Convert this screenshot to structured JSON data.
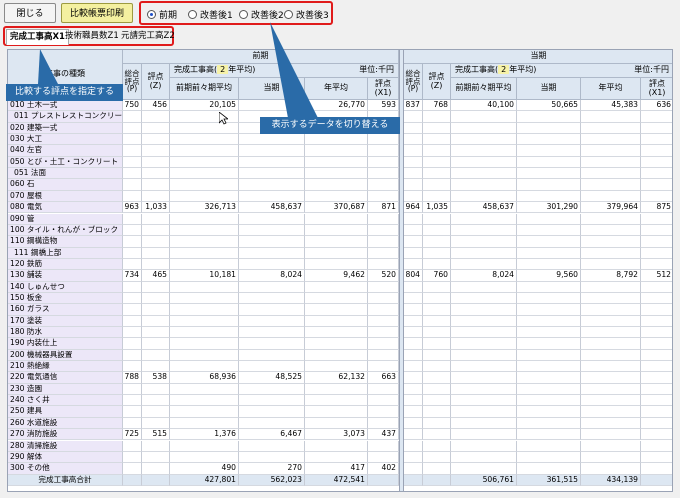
{
  "toolbar": {
    "close_label": "閉じる",
    "print_label": "比較帳票印刷"
  },
  "radios": [
    {
      "label": "前期",
      "selected": true
    },
    {
      "label": "改善後1",
      "selected": false
    },
    {
      "label": "改善後2",
      "selected": false
    },
    {
      "label": "改善後3",
      "selected": false
    }
  ],
  "tabs": [
    "完成工事高X1",
    "技術職員数Z1",
    "元請完工高Z2"
  ],
  "callouts": {
    "left": "比較する評点を指定する",
    "right": "表示するデータを切り替える"
  },
  "table": {
    "row_header": "工事の種類",
    "left_group": "前期",
    "right_group": "当期",
    "left_sub": "完成工事高(",
    "left_sub_val": "2",
    "left_sub_tail": "年平均)",
    "right_sub": "完成工事高(",
    "right_sub_val": "2",
    "right_sub_tail": "年平均)",
    "unit": "単位:千円",
    "col_sogo": "総合評点(P)",
    "col_hyoten_z": "評点(Z)",
    "col_prev_avg": "前期前々期平均",
    "col_curr": "当期",
    "col_year_avg": "年平均",
    "col_hyoten_x1": "評点(X1)",
    "total_label": "完成工事高合計"
  },
  "rows": [
    {
      "label": "010 土木一式",
      "l": [
        "750",
        "456",
        "20,105",
        "40,",
        "26,770",
        "593"
      ],
      "r": [
        "837",
        "768",
        "40,100",
        "50,665",
        "45,383",
        "636"
      ]
    },
    {
      "label": "011 プレストレストコンクリート",
      "l": [
        "",
        "",
        "",
        "",
        "",
        ""
      ],
      "r": [
        "",
        "",
        "",
        "",
        "",
        ""
      ],
      "sub": true
    },
    {
      "label": "020 建築一式",
      "l": [
        "",
        "",
        "",
        "",
        "",
        ""
      ],
      "r": [
        "",
        "",
        "",
        "",
        "",
        ""
      ]
    },
    {
      "label": "030 大工",
      "l": [
        "",
        "",
        "",
        "",
        "",
        ""
      ],
      "r": [
        "",
        "",
        "",
        "",
        "",
        ""
      ]
    },
    {
      "label": "040 左官",
      "l": [
        "",
        "",
        "",
        "",
        "",
        ""
      ],
      "r": [
        "",
        "",
        "",
        "",
        "",
        ""
      ]
    },
    {
      "label": "050 とび・土工・コンクリート",
      "l": [
        "",
        "",
        "",
        "",
        "",
        ""
      ],
      "r": [
        "",
        "",
        "",
        "",
        "",
        ""
      ]
    },
    {
      "label": "051 法面",
      "l": [
        "",
        "",
        "",
        "",
        "",
        ""
      ],
      "r": [
        "",
        "",
        "",
        "",
        "",
        ""
      ],
      "sub": true
    },
    {
      "label": "060 石",
      "l": [
        "",
        "",
        "",
        "",
        "",
        ""
      ],
      "r": [
        "",
        "",
        "",
        "",
        "",
        ""
      ]
    },
    {
      "label": "070 屋根",
      "l": [
        "",
        "",
        "",
        "",
        "",
        ""
      ],
      "r": [
        "",
        "",
        "",
        "",
        "",
        ""
      ]
    },
    {
      "label": "080 電気",
      "l": [
        "963",
        "1,033",
        "326,713",
        "458,637",
        "370,687",
        "871"
      ],
      "r": [
        "964",
        "1,035",
        "458,637",
        "301,290",
        "379,964",
        "875"
      ]
    },
    {
      "label": "090 管",
      "l": [
        "",
        "",
        "",
        "",
        "",
        ""
      ],
      "r": [
        "",
        "",
        "",
        "",
        "",
        ""
      ]
    },
    {
      "label": "100 タイル・れんが・ブロック",
      "l": [
        "",
        "",
        "",
        "",
        "",
        ""
      ],
      "r": [
        "",
        "",
        "",
        "",
        "",
        ""
      ]
    },
    {
      "label": "110 鋼構造物",
      "l": [
        "",
        "",
        "",
        "",
        "",
        ""
      ],
      "r": [
        "",
        "",
        "",
        "",
        "",
        ""
      ]
    },
    {
      "label": "111 鋼橋上部",
      "l": [
        "",
        "",
        "",
        "",
        "",
        ""
      ],
      "r": [
        "",
        "",
        "",
        "",
        "",
        ""
      ],
      "sub": true
    },
    {
      "label": "120 鉄筋",
      "l": [
        "",
        "",
        "",
        "",
        "",
        ""
      ],
      "r": [
        "",
        "",
        "",
        "",
        "",
        ""
      ]
    },
    {
      "label": "130 舗装",
      "l": [
        "734",
        "465",
        "10,181",
        "8,024",
        "9,462",
        "520"
      ],
      "r": [
        "804",
        "760",
        "8,024",
        "9,560",
        "8,792",
        "512"
      ]
    },
    {
      "label": "140 しゅんせつ",
      "l": [
        "",
        "",
        "",
        "",
        "",
        ""
      ],
      "r": [
        "",
        "",
        "",
        "",
        "",
        ""
      ]
    },
    {
      "label": "150 板金",
      "l": [
        "",
        "",
        "",
        "",
        "",
        ""
      ],
      "r": [
        "",
        "",
        "",
        "",
        "",
        ""
      ]
    },
    {
      "label": "160 ガラス",
      "l": [
        "",
        "",
        "",
        "",
        "",
        ""
      ],
      "r": [
        "",
        "",
        "",
        "",
        "",
        ""
      ]
    },
    {
      "label": "170 塗装",
      "l": [
        "",
        "",
        "",
        "",
        "",
        ""
      ],
      "r": [
        "",
        "",
        "",
        "",
        "",
        ""
      ]
    },
    {
      "label": "180 防水",
      "l": [
        "",
        "",
        "",
        "",
        "",
        ""
      ],
      "r": [
        "",
        "",
        "",
        "",
        "",
        ""
      ]
    },
    {
      "label": "190 内装仕上",
      "l": [
        "",
        "",
        "",
        "",
        "",
        ""
      ],
      "r": [
        "",
        "",
        "",
        "",
        "",
        ""
      ]
    },
    {
      "label": "200 機械器具設置",
      "l": [
        "",
        "",
        "",
        "",
        "",
        ""
      ],
      "r": [
        "",
        "",
        "",
        "",
        "",
        ""
      ]
    },
    {
      "label": "210 熱絶縁",
      "l": [
        "",
        "",
        "",
        "",
        "",
        ""
      ],
      "r": [
        "",
        "",
        "",
        "",
        "",
        ""
      ]
    },
    {
      "label": "220 電気通信",
      "l": [
        "788",
        "538",
        "68,936",
        "48,525",
        "62,132",
        "663"
      ],
      "r": [
        "",
        "",
        "",
        "",
        "",
        ""
      ]
    },
    {
      "label": "230 造園",
      "l": [
        "",
        "",
        "",
        "",
        "",
        ""
      ],
      "r": [
        "",
        "",
        "",
        "",
        "",
        ""
      ]
    },
    {
      "label": "240 さく井",
      "l": [
        "",
        "",
        "",
        "",
        "",
        ""
      ],
      "r": [
        "",
        "",
        "",
        "",
        "",
        ""
      ]
    },
    {
      "label": "250 建具",
      "l": [
        "",
        "",
        "",
        "",
        "",
        ""
      ],
      "r": [
        "",
        "",
        "",
        "",
        "",
        ""
      ]
    },
    {
      "label": "260 水道施設",
      "l": [
        "",
        "",
        "",
        "",
        "",
        ""
      ],
      "r": [
        "",
        "",
        "",
        "",
        "",
        ""
      ]
    },
    {
      "label": "270 消防施設",
      "l": [
        "725",
        "515",
        "1,376",
        "6,467",
        "3,073",
        "437"
      ],
      "r": [
        "",
        "",
        "",
        "",
        "",
        ""
      ]
    },
    {
      "label": "280 清掃施設",
      "l": [
        "",
        "",
        "",
        "",
        "",
        ""
      ],
      "r": [
        "",
        "",
        "",
        "",
        "",
        ""
      ]
    },
    {
      "label": "290 解体",
      "l": [
        "",
        "",
        "",
        "",
        "",
        ""
      ],
      "r": [
        "",
        "",
        "",
        "",
        "",
        ""
      ]
    },
    {
      "label": "300 その他",
      "l": [
        "",
        "",
        "490",
        "270",
        "417",
        "402"
      ],
      "r": [
        "",
        "",
        "",
        "",
        "",
        ""
      ]
    }
  ],
  "totals": {
    "l": [
      "",
      "",
      "427,801",
      "562,023",
      "472,541",
      ""
    ],
    "r": [
      "",
      "",
      "506,761",
      "361,515",
      "434,139",
      ""
    ]
  }
}
